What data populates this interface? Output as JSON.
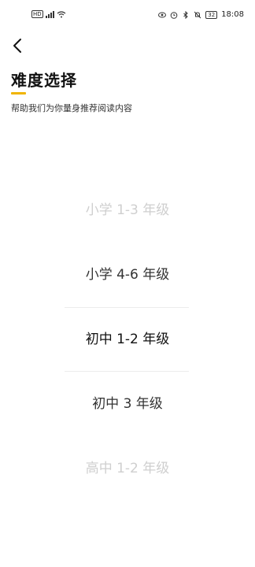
{
  "status_bar": {
    "left_badge": "HD",
    "time": "18:08",
    "battery": "32"
  },
  "header": {
    "title": "难度选择",
    "subtitle": "帮助我们为你量身推荐阅读内容"
  },
  "picker": {
    "options": [
      "小学 1-3 年级",
      "小学 4-6 年级",
      "初中 1-2 年级",
      "初中 3 年级",
      "高中 1-2 年级"
    ],
    "selected_index": 2
  },
  "colors": {
    "accent": "#F0B400",
    "faded_text": "#cfcfcf",
    "divider": "#ececec"
  }
}
